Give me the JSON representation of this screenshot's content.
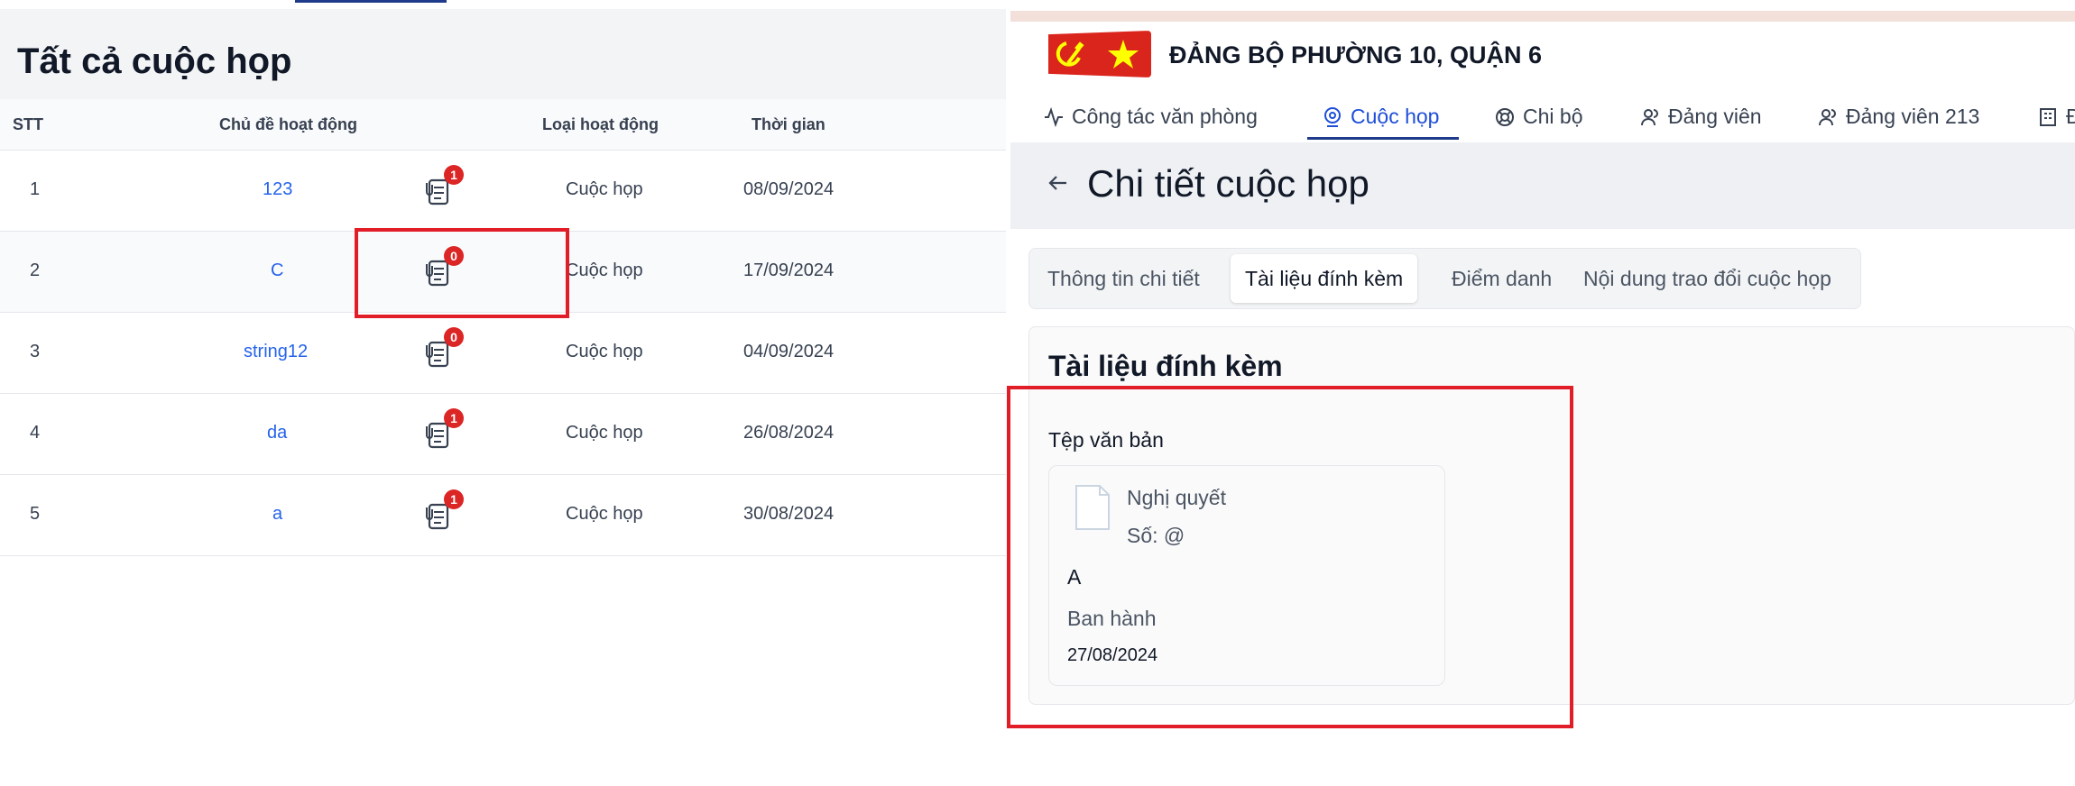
{
  "left": {
    "title": "Tất cả cuộc họp",
    "columns": [
      "STT",
      "Chủ đề hoạt động",
      "Loại hoạt động",
      "Thời gian"
    ],
    "rows": [
      {
        "stt": "1",
        "topic": "123",
        "badge": "1",
        "type": "Cuộc họp",
        "date": "08/09/2024"
      },
      {
        "stt": "2",
        "topic": "C",
        "badge": "0",
        "type": "Cuộc họp",
        "date": "17/09/2024"
      },
      {
        "stt": "3",
        "topic": "string12",
        "badge": "0",
        "type": "Cuộc họp",
        "date": "04/09/2024"
      },
      {
        "stt": "4",
        "topic": "da",
        "badge": "1",
        "type": "Cuộc họp",
        "date": "26/08/2024"
      },
      {
        "stt": "5",
        "topic": "a",
        "badge": "1",
        "type": "Cuộc họp",
        "date": "30/08/2024"
      }
    ]
  },
  "right": {
    "org_title": "ĐẢNG BỘ PHƯỜNG 10, QUẬN 6",
    "nav": [
      {
        "label": "Công tác văn phòng",
        "icon": "activity-icon"
      },
      {
        "label": "Cuộc họp",
        "icon": "webcam-icon"
      },
      {
        "label": "Chi bộ",
        "icon": "lifebuoy-icon"
      },
      {
        "label": "Đảng viên",
        "icon": "user-icon"
      },
      {
        "label": "Đảng viên 213",
        "icon": "user-icon"
      },
      {
        "label": "Đ",
        "icon": "building-icon"
      }
    ],
    "page_title": "Chi tiết cuộc họp",
    "tabs": [
      "Thông tin chi tiết",
      "Tài liệu đính kèm",
      "Điểm danh",
      "Nội dung trao đổi cuộc họp"
    ],
    "card_title": "Tài liệu đính kèm",
    "section_label": "Tệp văn bản",
    "file": {
      "type": "Nghị quyết",
      "number": "Số: @",
      "name": "A",
      "status": "Ban hành",
      "date": "27/08/2024"
    }
  },
  "colors": {
    "accent": "#1d4ed8",
    "badge": "#dc2626",
    "highlight": "#e11d28",
    "flag_red": "#da251d",
    "flag_yellow": "#ffff00"
  }
}
